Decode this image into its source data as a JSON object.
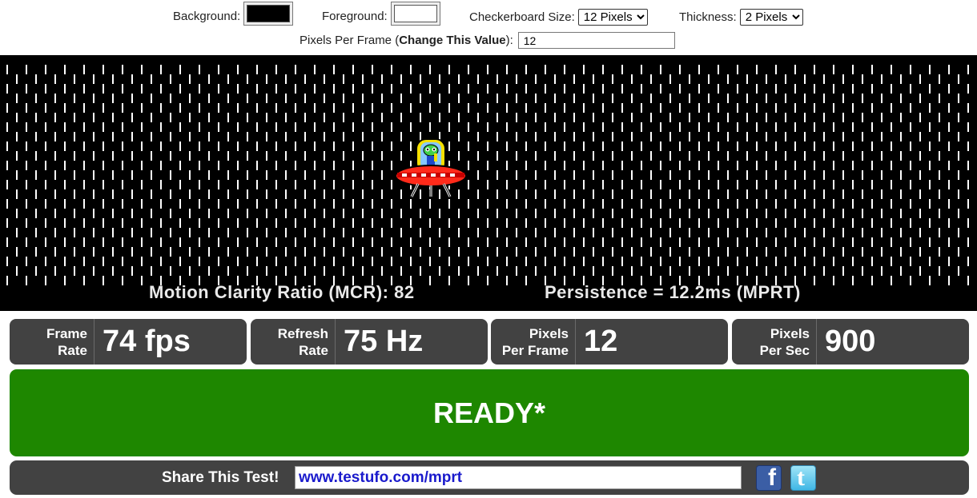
{
  "controls": {
    "background_label": "Background:",
    "background_color": "#000000",
    "foreground_label": "Foreground:",
    "foreground_color": "#ffffff",
    "checker_label": "Checkerboard Size:",
    "checker_value": "12 Pixels",
    "thickness_label": "Thickness:",
    "thickness_value": "2 Pixels",
    "ppf_label_pre": "Pixels Per Frame (",
    "ppf_label_bold": "Change This Value",
    "ppf_label_post": "):",
    "ppf_value": "12"
  },
  "test": {
    "mcr": "Motion Clarity Ratio (MCR): 82",
    "persistence": "Persistence = 12.2ms (MPRT)"
  },
  "stats": [
    {
      "label1": "Frame",
      "label2": "Rate",
      "value": "74 fps"
    },
    {
      "label1": "Refresh",
      "label2": "Rate",
      "value": "75 Hz"
    },
    {
      "label1": "Pixels",
      "label2": "Per Frame",
      "value": "12"
    },
    {
      "label1": "Pixels",
      "label2": "Per Sec",
      "value": "900"
    }
  ],
  "status": "READY*",
  "share": {
    "label": "Share This Test!",
    "url": "www.testufo.com/mprt",
    "facebook_icon": "facebook-icon",
    "twitter_icon": "twitter-icon"
  }
}
